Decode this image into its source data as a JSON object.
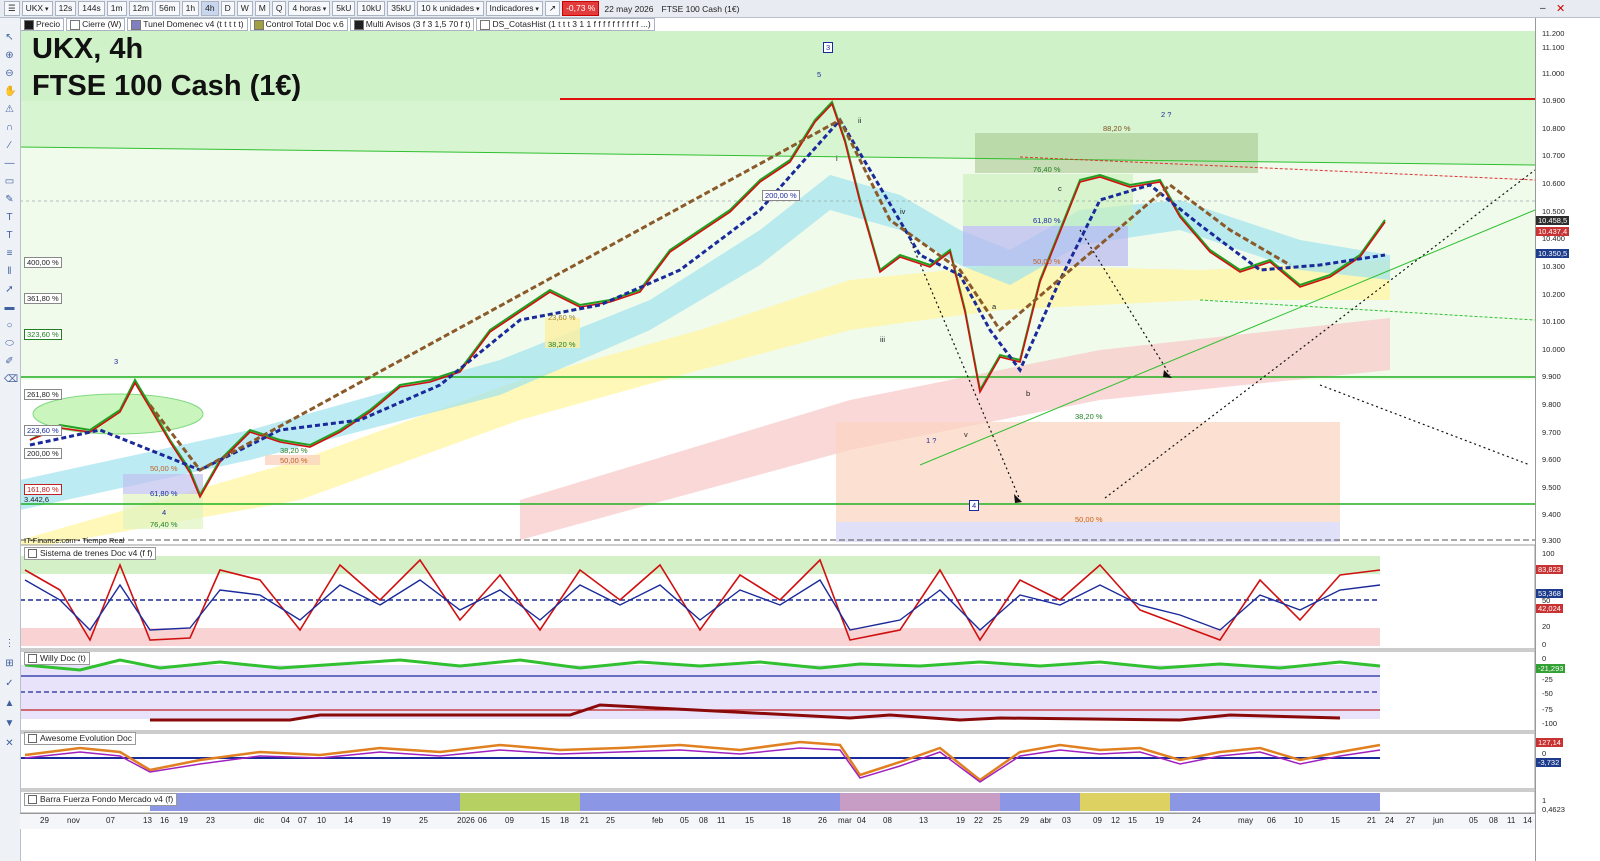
{
  "toolbar": {
    "symbol": "UKX",
    "timeframes": [
      "12s",
      "144s",
      "1m",
      "12m",
      "56m",
      "1h",
      "4h",
      "D",
      "W",
      "M",
      "Q"
    ],
    "period": "4 horas",
    "units": [
      "5kU",
      "10kU",
      "35kU"
    ],
    "unit_select": "10 k unidades",
    "indicators_label": "Indicadores",
    "change_badge": "-0,73 %",
    "date": "22 may 2026",
    "instrument": "FTSE 100 Cash (1€)"
  },
  "indicator_bar": [
    {
      "label": "Precio",
      "color": "#1a1a1a"
    },
    {
      "label": "Cierre (W)",
      "color": "#ffffff"
    },
    {
      "label": "Tunel Domenec v4 (t t t t t)",
      "color": "#8080c0"
    },
    {
      "label": "Control Total Doc v.6",
      "color": "#a0a040"
    },
    {
      "label": "Multi Avisos (3 f 3 1,5 70 f t)",
      "color": "#202020"
    },
    {
      "label": "DS_CotasHist (1 t t t 3 1 1 f f f f f f f f f f ...)",
      "color": "#ffffff"
    }
  ],
  "title": {
    "line1": "UKX, 4h",
    "line2": "FTSE 100 Cash (1€)"
  },
  "source_label": "IT-Finance.com - Tiempo Real",
  "price_axis": [
    "11.200",
    "11.100",
    "11.000",
    "10.900",
    "10.800",
    "10.700",
    "10.600",
    "10.500",
    "10.400",
    "10.300",
    "10.200",
    "10.100",
    "10.000",
    "9.900",
    "9.800",
    "9.700",
    "9.600",
    "9.500",
    "9.400",
    "9.300"
  ],
  "price_badges": [
    {
      "text": "10.458,5",
      "color": "#2d2d2d"
    },
    {
      "text": "10.437,4",
      "color": "#c83232"
    },
    {
      "text": "10.350,5",
      "color": "#1e3c8c"
    }
  ],
  "fib_left": [
    "400,00 %",
    "361,80 %",
    "323,60 %",
    "261,80 %",
    "223,60 %",
    "200,00 %",
    "161,80 %",
    "3.442,6"
  ],
  "fib_mid": [
    "200,00 %",
    "38,20 %",
    "23,60 %",
    "38,20 %",
    "50,00 %",
    "61,80 %",
    "76,40 %",
    "50,00 %"
  ],
  "fib_right": [
    "88,20 %",
    "76,40 %",
    "61,80 %",
    "50,00 %",
    "38,20 %",
    "50,00 %"
  ],
  "wave_labels": [
    "3",
    "4",
    "5",
    "3",
    "i",
    "ii",
    "iii",
    "iv",
    "v",
    "1 ?",
    "a",
    "b",
    "c",
    "2 ?",
    "4"
  ],
  "panels": [
    {
      "title": "Sistema de trenes Doc v4 (f f)",
      "axis": [
        "100",
        "50",
        "20",
        "0"
      ],
      "badges": [
        {
          "text": "83,823",
          "color": "#c83232"
        },
        {
          "text": "53,368",
          "color": "#1e3c8c"
        },
        {
          "text": "42,024",
          "color": "#c83232"
        }
      ]
    },
    {
      "title": "Willy Doc (t)",
      "axis": [
        "0",
        "-25",
        "-50",
        "-75",
        "-100"
      ],
      "badges": [
        {
          "text": "-21,293",
          "color": "#32a032"
        }
      ]
    },
    {
      "title": "Awesome Evolution Doc",
      "axis": [
        "0"
      ],
      "badges": [
        {
          "text": "127,14",
          "color": "#c83232"
        },
        {
          "text": "-3,732",
          "color": "#1e3c8c"
        }
      ]
    },
    {
      "title": "Barra Fuerza Fondo Mercado v4 (f)",
      "axis": [
        "1",
        "0,4623"
      ],
      "badges": []
    }
  ],
  "x_axis": [
    "29",
    "nov",
    "07",
    "13",
    "16",
    "19",
    "23",
    "dic",
    "04",
    "07",
    "10",
    "14",
    "19",
    "25",
    "2026",
    "06",
    "09",
    "15",
    "18",
    "21",
    "25",
    "feb",
    "05",
    "08",
    "11",
    "15",
    "18",
    "26",
    "mar",
    "04",
    "08",
    "13",
    "19",
    "22",
    "25",
    "29",
    "abr",
    "03",
    "09",
    "12",
    "15",
    "19",
    "24",
    "may",
    "06",
    "10",
    "15",
    "21",
    "24",
    "27",
    "jun",
    "05",
    "08",
    "11",
    "14"
  ]
}
